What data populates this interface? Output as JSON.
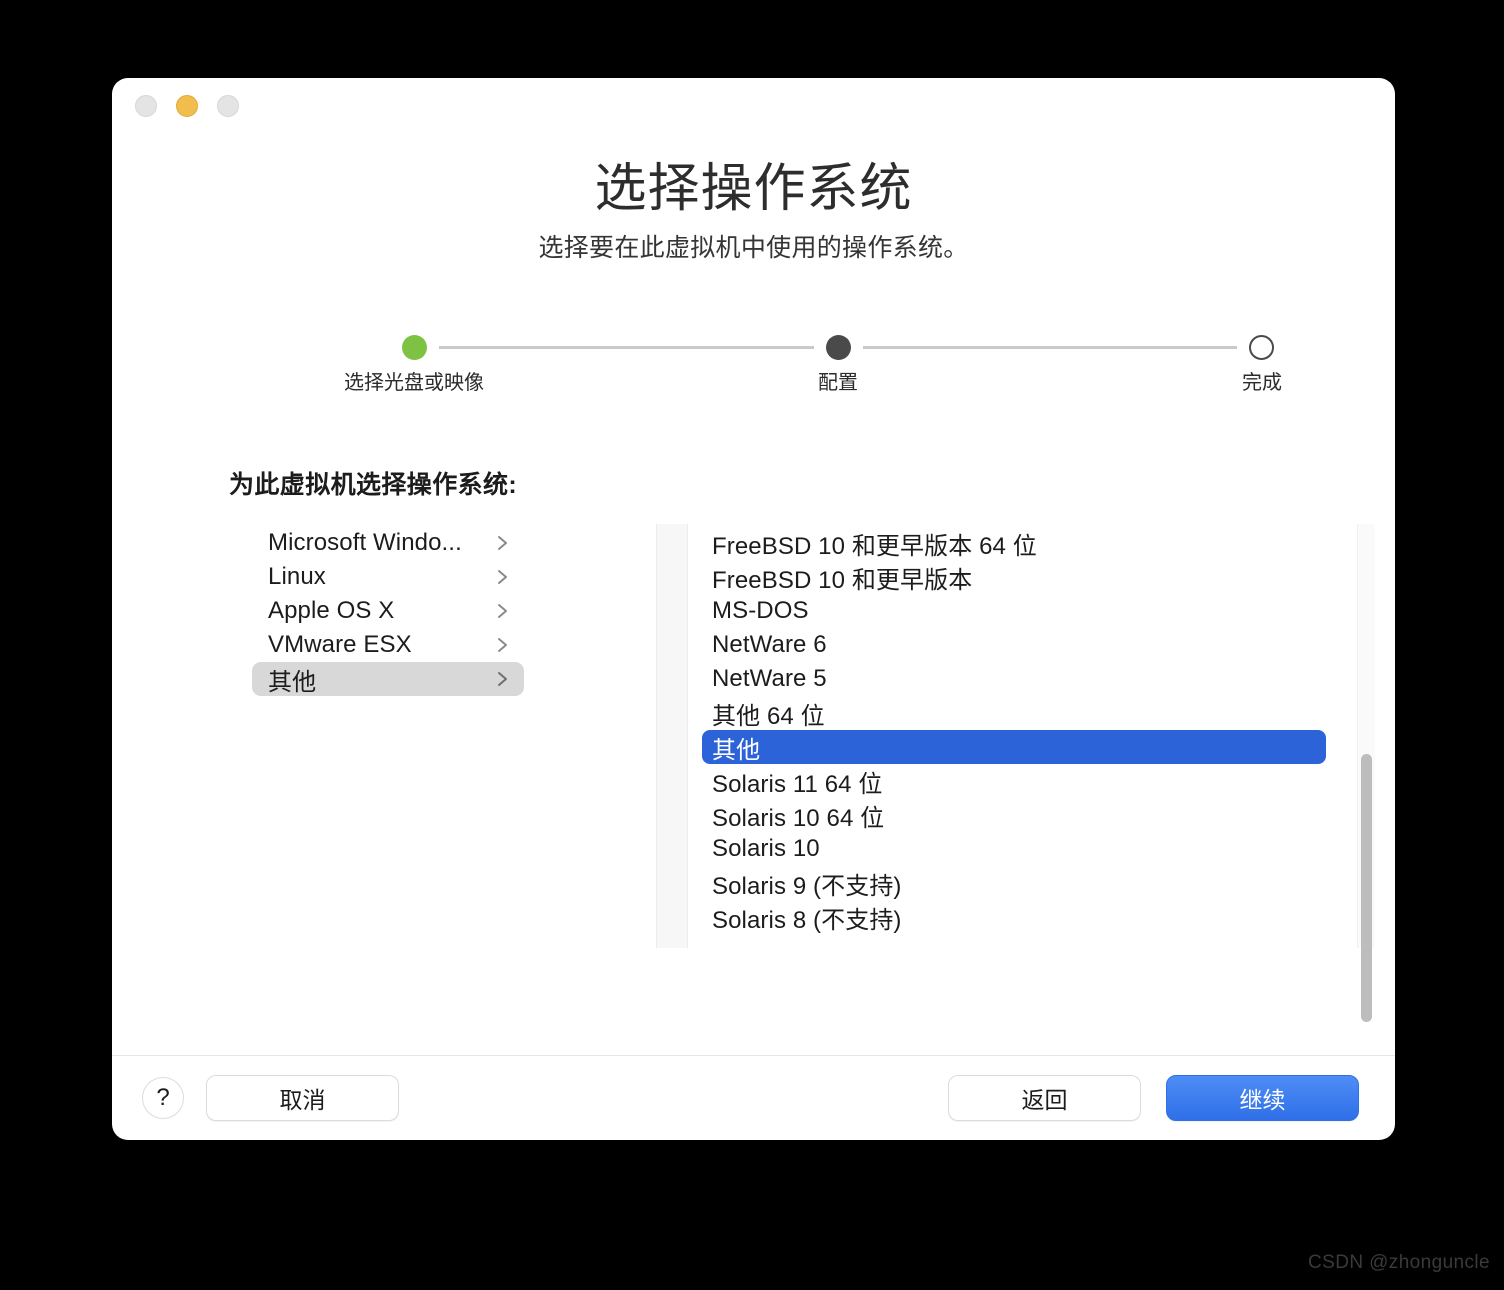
{
  "window": {
    "traffic_lights": [
      {
        "name": "close",
        "label": "关闭",
        "color": "#e4e4e4"
      },
      {
        "name": "minimize",
        "label": "最小化",
        "color": "#f1bd4c"
      },
      {
        "name": "maximize",
        "label": "最大化",
        "color": "#e4e4e4"
      }
    ]
  },
  "header": {
    "title": "选择操作系统",
    "subtitle": "选择要在此虚拟机中使用的操作系统。"
  },
  "stepper": {
    "steps": [
      {
        "label": "选择光盘或映像",
        "state": "done",
        "color": "#7dc242"
      },
      {
        "label": "配置",
        "state": "current",
        "color": "#4a4a4a"
      },
      {
        "label": "完成",
        "state": "pending",
        "color": "#ffffff"
      }
    ]
  },
  "section": {
    "heading": "为此虚拟机选择操作系统:"
  },
  "categories": {
    "selected_index": 4,
    "items": [
      {
        "label": "Microsoft Windo...",
        "selected": false
      },
      {
        "label": "Linux",
        "selected": false
      },
      {
        "label": "Apple OS X",
        "selected": false
      },
      {
        "label": "VMware ESX",
        "selected": false
      },
      {
        "label": "其他",
        "selected": true
      }
    ]
  },
  "os_list": {
    "selected_index": 6,
    "selection_color": "#2c63d8",
    "items": [
      {
        "label": "FreeBSD 10 和更早版本 64 位",
        "selected": false
      },
      {
        "label": "FreeBSD 10 和更早版本",
        "selected": false
      },
      {
        "label": "MS-DOS",
        "selected": false
      },
      {
        "label": "NetWare 6",
        "selected": false
      },
      {
        "label": "NetWare 5",
        "selected": false
      },
      {
        "label": "其他 64 位",
        "selected": false
      },
      {
        "label": "其他",
        "selected": true
      },
      {
        "label": "Solaris 11 64 位",
        "selected": false
      },
      {
        "label": "Solaris 10 64 位",
        "selected": false
      },
      {
        "label": "Solaris 10",
        "selected": false
      },
      {
        "label": "Solaris 9 (不支持)",
        "selected": false
      },
      {
        "label": "Solaris 8 (不支持)",
        "selected": false
      }
    ]
  },
  "footer": {
    "help_label": "?",
    "cancel_label": "取消",
    "back_label": "返回",
    "continue_label": "继续",
    "continue_color": "#2f6fe8"
  },
  "watermark": "CSDN @zhonguncle"
}
